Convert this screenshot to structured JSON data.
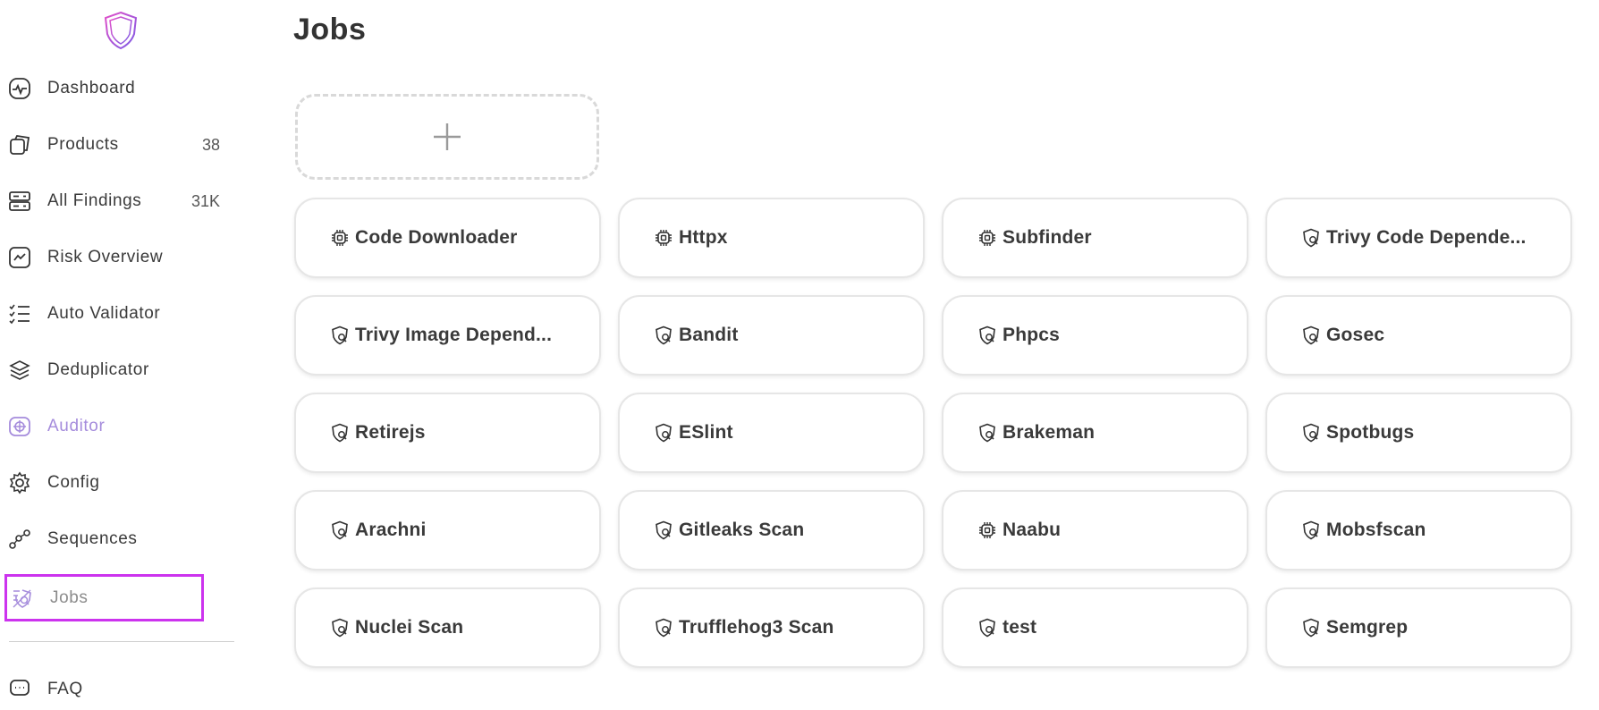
{
  "sidebar": {
    "items": [
      {
        "label": "Dashboard",
        "count": "",
        "icon": "dashboard-icon"
      },
      {
        "label": "Products",
        "count": "38",
        "icon": "products-icon"
      },
      {
        "label": "All Findings",
        "count": "31K",
        "icon": "findings-icon"
      },
      {
        "label": "Risk Overview",
        "count": "",
        "icon": "risk-overview-icon"
      },
      {
        "label": "Auto Validator",
        "count": "",
        "icon": "auto-validator-icon"
      },
      {
        "label": "Deduplicator",
        "count": "",
        "icon": "deduplicator-icon"
      },
      {
        "label": "Auditor",
        "count": "",
        "icon": "auditor-icon"
      },
      {
        "label": "Config",
        "count": "",
        "icon": "gear-icon"
      },
      {
        "label": "Sequences",
        "count": "",
        "icon": "sequences-icon"
      },
      {
        "label": "Jobs",
        "count": "",
        "icon": "jobs-icon"
      },
      {
        "label": "FAQ",
        "count": "",
        "icon": "faq-icon"
      }
    ],
    "accent_color": "#a58cdc",
    "selected_outline_color": "#cc33ee"
  },
  "main": {
    "title": "Jobs",
    "jobs": [
      {
        "label": "Code Downloader",
        "icon": "chip-icon"
      },
      {
        "label": "Httpx",
        "icon": "chip-icon"
      },
      {
        "label": "Subfinder",
        "icon": "chip-icon"
      },
      {
        "label": "Trivy Code Depende...",
        "icon": "shield-search-icon"
      },
      {
        "label": "Trivy Image Depend...",
        "icon": "shield-search-icon"
      },
      {
        "label": "Bandit",
        "icon": "shield-search-icon"
      },
      {
        "label": "Phpcs",
        "icon": "shield-search-icon"
      },
      {
        "label": "Gosec",
        "icon": "shield-search-icon"
      },
      {
        "label": "Retirejs",
        "icon": "shield-search-icon"
      },
      {
        "label": "ESlint",
        "icon": "shield-search-icon"
      },
      {
        "label": "Brakeman",
        "icon": "shield-search-icon"
      },
      {
        "label": "Spotbugs",
        "icon": "shield-search-icon"
      },
      {
        "label": "Arachni",
        "icon": "shield-search-icon"
      },
      {
        "label": "Gitleaks Scan",
        "icon": "shield-search-icon"
      },
      {
        "label": "Naabu",
        "icon": "chip-icon"
      },
      {
        "label": "Mobsfscan",
        "icon": "shield-search-icon"
      },
      {
        "label": "Nuclei Scan",
        "icon": "shield-search-icon"
      },
      {
        "label": "Trufflehog3 Scan",
        "icon": "shield-search-icon"
      },
      {
        "label": "test",
        "icon": "shield-search-icon"
      },
      {
        "label": "Semgrep",
        "icon": "shield-search-icon"
      }
    ]
  }
}
